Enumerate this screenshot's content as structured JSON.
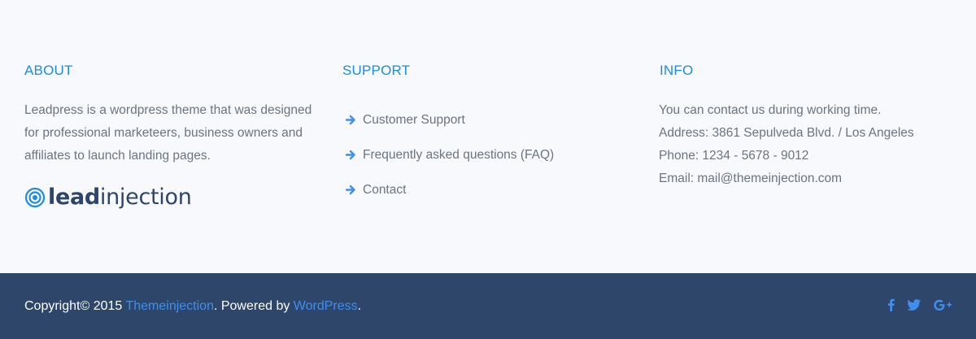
{
  "about": {
    "heading": "ABOUT",
    "text": "Leadpress is a wordpress theme that was designed for professional marketeers, business owners and affiliates to launch landing pages.",
    "logo": {
      "bold_part": "lead",
      "regular_part": "injection",
      "icon": "target-icon"
    }
  },
  "support": {
    "heading": "SUPPORT",
    "items": [
      {
        "label": "Customer Support",
        "icon": "arrow-right-icon"
      },
      {
        "label": "Frequently asked questions (FAQ)",
        "icon": "arrow-right-icon"
      },
      {
        "label": "Contact",
        "icon": "arrow-right-icon"
      }
    ]
  },
  "info": {
    "heading": "INFO",
    "lines": [
      "You can contact us during working time.",
      "Address: 3861 Sepulveda Blvd. / Los Angeles",
      "Phone: 1234 - 5678 - 9012",
      "Email: mail@themeinjection.com"
    ]
  },
  "footer": {
    "copyright_prefix": "Copyright© 2015 ",
    "company_link": "Themeinjection",
    "powered_by": ". Powered by ",
    "platform_link": "WordPress",
    "suffix": ".",
    "social": [
      "facebook-icon",
      "twitter-icon",
      "google-plus-icon"
    ]
  },
  "colors": {
    "accent": "#1a8be6",
    "link": "#3f8ff0",
    "text": "#6b7480",
    "bottom_bar": "#2d466a",
    "logo": "#2e456b",
    "background": "#f7f9fc"
  }
}
